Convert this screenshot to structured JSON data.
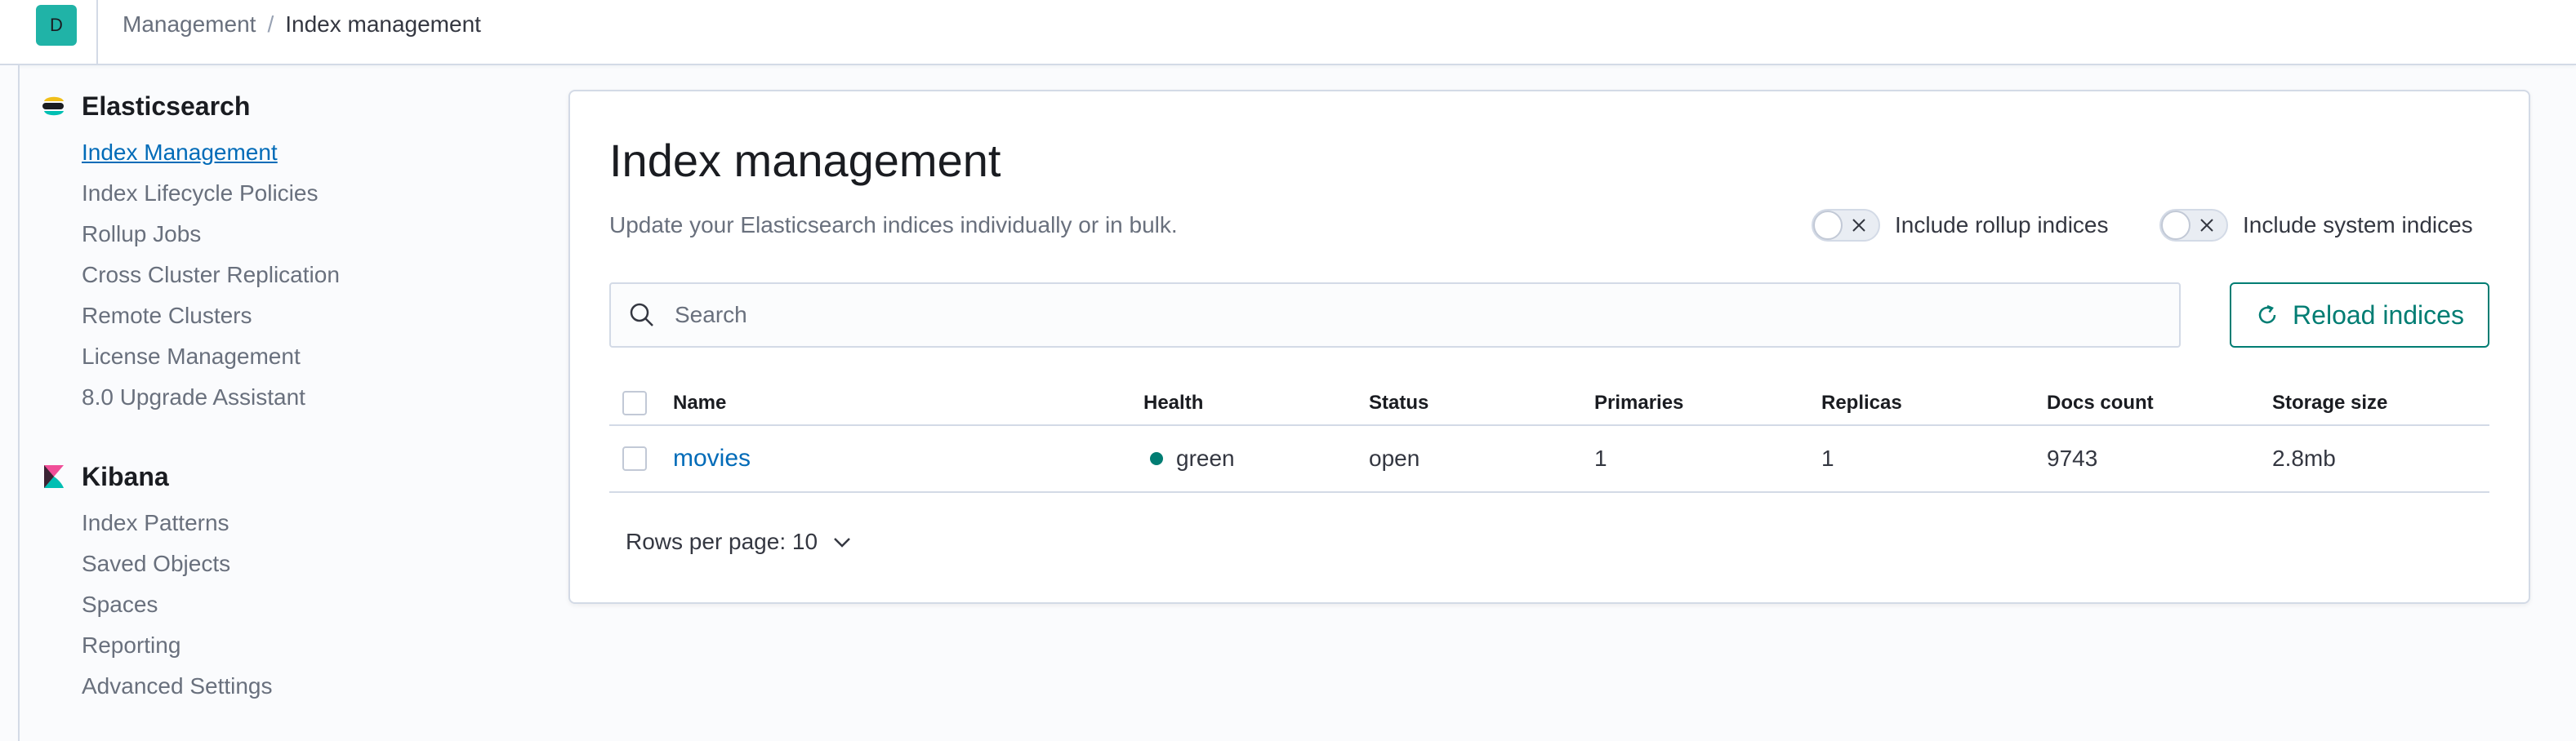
{
  "header": {
    "avatar_initial": "D",
    "breadcrumbs": [
      "Management",
      "Index management"
    ]
  },
  "sidebar": {
    "groups": [
      {
        "title": "Elasticsearch",
        "icon": "elasticsearch-logo-icon",
        "items": [
          {
            "label": "Index Management",
            "active": true
          },
          {
            "label": "Index Lifecycle Policies"
          },
          {
            "label": "Rollup Jobs"
          },
          {
            "label": "Cross Cluster Replication"
          },
          {
            "label": "Remote Clusters"
          },
          {
            "label": "License Management"
          },
          {
            "label": "8.0 Upgrade Assistant"
          }
        ]
      },
      {
        "title": "Kibana",
        "icon": "kibana-logo-icon",
        "items": [
          {
            "label": "Index Patterns"
          },
          {
            "label": "Saved Objects"
          },
          {
            "label": "Spaces"
          },
          {
            "label": "Reporting"
          },
          {
            "label": "Advanced Settings"
          }
        ]
      }
    ]
  },
  "main": {
    "title": "Index management",
    "description": "Update your Elasticsearch indices individually or in bulk.",
    "toggles": {
      "rollup": {
        "label": "Include rollup indices",
        "checked": false
      },
      "system": {
        "label": "Include system indices",
        "checked": false
      }
    },
    "search": {
      "placeholder": "Search",
      "value": ""
    },
    "reload_label": "Reload indices",
    "table": {
      "columns": [
        "Name",
        "Health",
        "Status",
        "Primaries",
        "Replicas",
        "Docs count",
        "Storage size"
      ],
      "rows": [
        {
          "name": "movies",
          "health": "green",
          "status": "open",
          "primaries": "1",
          "replicas": "1",
          "docs_count": "9743",
          "storage_size": "2.8mb"
        }
      ]
    },
    "pagination": {
      "rows_per_page_label": "Rows per page: 10"
    }
  },
  "colors": {
    "accent": "#006bb8",
    "primary_button": "#017d73",
    "health_green": "#017d73",
    "avatar_bg": "#20b3a7"
  }
}
